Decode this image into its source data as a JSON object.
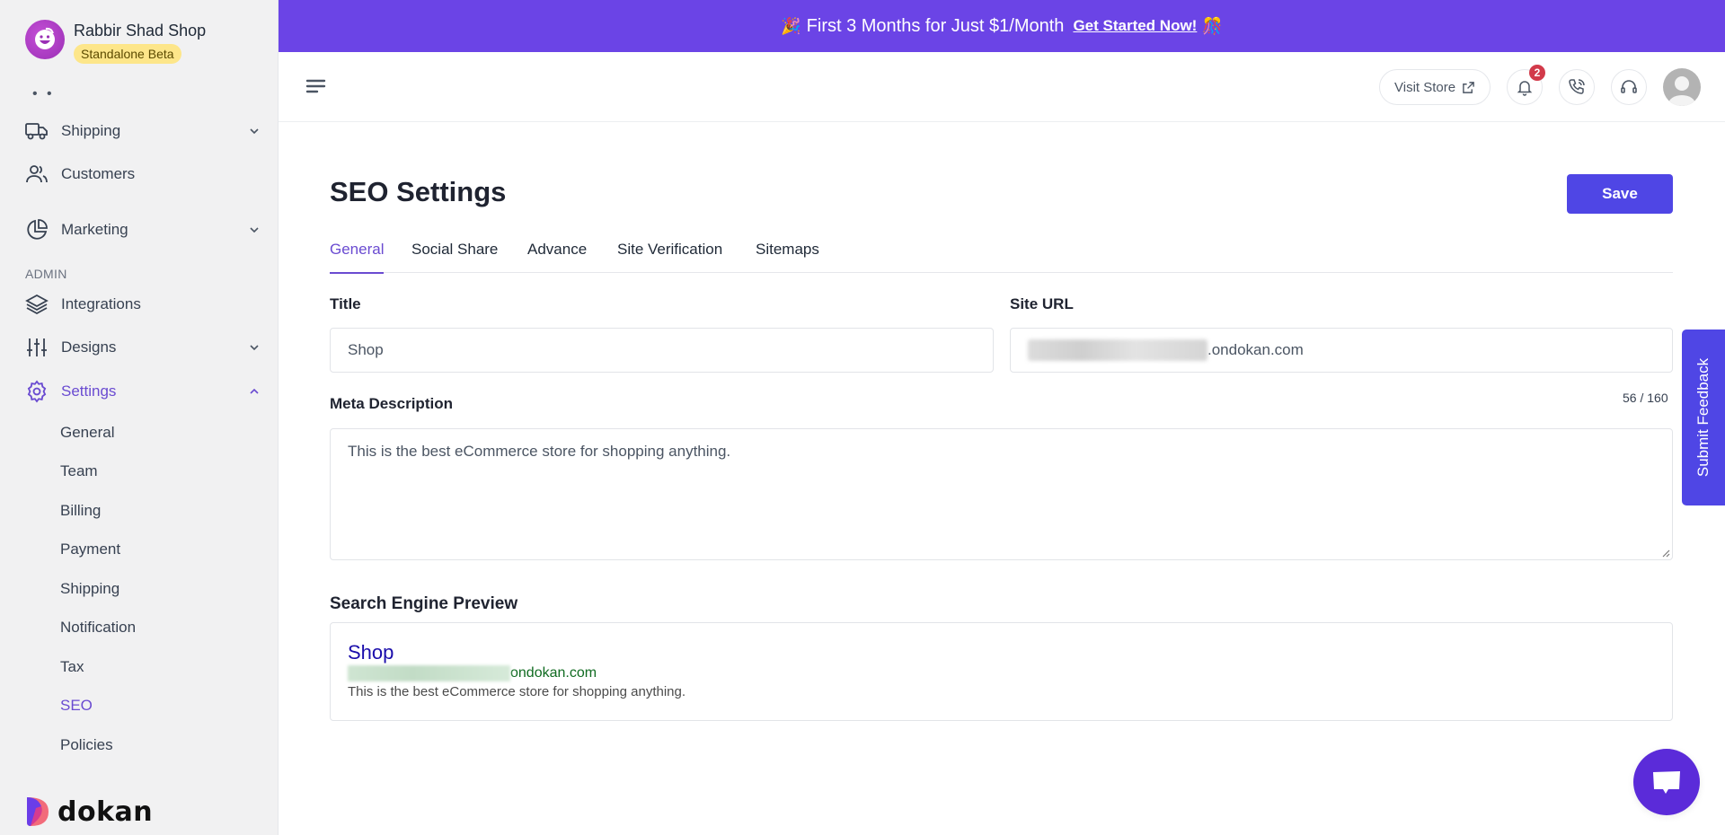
{
  "sidebar": {
    "store_name": "Rabbir Shad Shop",
    "store_badge": "Standalone Beta",
    "overflow_dots": "• •",
    "items": [
      {
        "label": "Shipping",
        "icon": "truck-icon",
        "expandable": true
      },
      {
        "label": "Customers",
        "icon": "users-icon",
        "expandable": false
      },
      {
        "label": "Marketing",
        "icon": "pie-chart-icon",
        "expandable": true
      }
    ],
    "admin_label": "ADMIN",
    "admin_items": [
      {
        "label": "Integrations",
        "icon": "layers-icon",
        "expandable": false
      },
      {
        "label": "Designs",
        "icon": "sliders-icon",
        "expandable": true
      },
      {
        "label": "Settings",
        "icon": "gear-icon",
        "expandable": true,
        "expanded": true,
        "active": true
      }
    ],
    "settings_submenu": [
      {
        "label": "General"
      },
      {
        "label": "Team"
      },
      {
        "label": "Billing"
      },
      {
        "label": "Payment"
      },
      {
        "label": "Shipping"
      },
      {
        "label": "Notification"
      },
      {
        "label": "Tax"
      },
      {
        "label": "SEO",
        "active": true
      },
      {
        "label": "Policies"
      }
    ],
    "logo_text": "dokan"
  },
  "promo": {
    "text": "First 3 Months for Just $1/Month",
    "link": "Get Started Now!",
    "emoji_left": "🎉",
    "emoji_right": "🎊"
  },
  "header": {
    "visit_store": "Visit Store",
    "notification_count": "2"
  },
  "main": {
    "title": "SEO Settings",
    "save_label": "Save",
    "tabs": [
      {
        "label": "General",
        "active": true
      },
      {
        "label": "Social Share"
      },
      {
        "label": "Advance"
      },
      {
        "label": "Site Verification"
      },
      {
        "label": "Sitemaps"
      }
    ],
    "title_label": "Title",
    "title_value": "Shop",
    "site_url_label": "Site URL",
    "site_url_visible_suffix": ".ondokan.com",
    "meta_label": "Meta Description",
    "meta_counter": "56 / 160",
    "meta_value": "This is the best eCommerce store for shopping anything.",
    "preview_heading": "Search Engine Preview",
    "preview": {
      "title": "Shop",
      "url_suffix": "ondokan.com",
      "description": "This is the best eCommerce store for shopping anything."
    }
  },
  "feedback_label": "Submit Feedback",
  "colors": {
    "accent": "#6a4bd1",
    "primary_button": "#4f46e5",
    "promo_bg": "#6b44e6",
    "badge_bg": "#fde68a",
    "notif_badge": "#d23a4a",
    "preview_title": "#1a0dab",
    "preview_url": "#106b21"
  }
}
